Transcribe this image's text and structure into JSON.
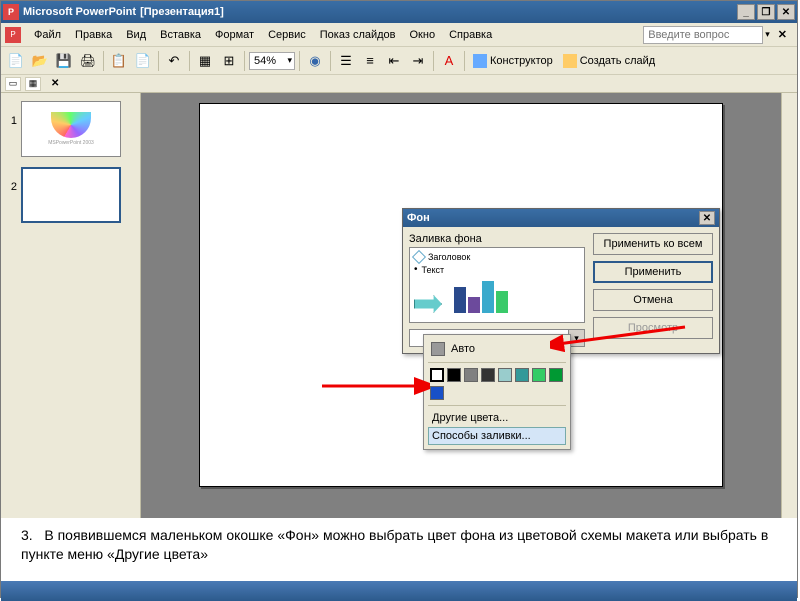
{
  "titlebar": {
    "app": "Microsoft PowerPoint",
    "doc": "[Презентация1]"
  },
  "menu": {
    "file": "Файл",
    "edit": "Правка",
    "view": "Вид",
    "insert": "Вставка",
    "format": "Формат",
    "tools": "Сервис",
    "slideshow": "Показ слайдов",
    "window": "Окно",
    "help": "Справка",
    "help_placeholder": "Введите вопрос"
  },
  "toolbar": {
    "zoom": "54%",
    "designer": "Конструктор",
    "new_slide": "Создать слайд"
  },
  "thumbnails": {
    "n1": "1",
    "n2": "2",
    "thumb1_label": "MSPowerPoint 2003"
  },
  "dialog": {
    "title": "Фон",
    "group_label": "Заливка фона",
    "preview_title": "Заголовок",
    "preview_text": "Текст",
    "btn_apply_all": "Применить ко всем",
    "btn_apply": "Применить",
    "btn_cancel": "Отмена",
    "btn_preview": "Просмотр"
  },
  "popup": {
    "auto": "Авто",
    "more_colors": "Другие цвета...",
    "fill_effects": "Способы заливки...",
    "colors": [
      "#ffffff",
      "#000000",
      "#808080",
      "#333333",
      "#99cccc",
      "#339999",
      "#33cc66",
      "#009933"
    ]
  },
  "caption": {
    "num": "3.",
    "text": "В появившемся маленьком окошке «Фон» можно выбрать цвет фона из цветовой схемы макета или выбрать в пункте меню «Другие цвета»"
  }
}
